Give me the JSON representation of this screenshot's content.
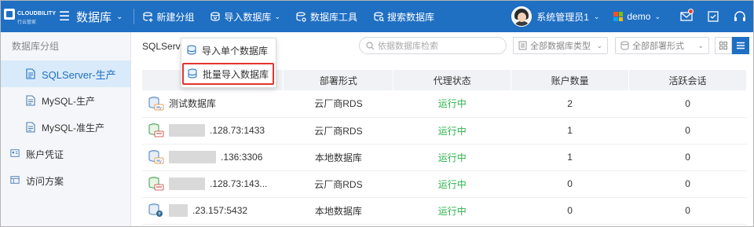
{
  "header": {
    "logo_text": "CLOUDBILITY",
    "logo_sub": "行云管家",
    "app_title": "数据库",
    "nav": [
      {
        "label": "新建分组",
        "icon": "new-group-icon"
      },
      {
        "label": "导入数据库",
        "icon": "import-db-icon"
      },
      {
        "label": "数据库工具",
        "icon": "db-tools-icon"
      },
      {
        "label": "搜索数据库",
        "icon": "search-db-icon"
      }
    ],
    "user_name": "系统管理员1",
    "org_name": "demo"
  },
  "sidebar": {
    "header": "数据库分组",
    "groups": [
      {
        "label": "SQLServer-生产",
        "active": true
      },
      {
        "label": "MySQL-生产",
        "active": false
      },
      {
        "label": "MySQL-准生产",
        "active": false
      }
    ],
    "items": [
      {
        "label": "账户凭证",
        "icon": "credential-icon"
      },
      {
        "label": "访问方案",
        "icon": "access-plan-icon"
      }
    ]
  },
  "main": {
    "breadcrumb": "SQLServer",
    "search_placeholder": "依据数据库检索",
    "filter_type": "全部数据库类型",
    "filter_deploy": "全部部署形式"
  },
  "dropdown": {
    "items": [
      "导入单个数据库",
      "批量导入数据库"
    ]
  },
  "table": {
    "columns": [
      "",
      "部署形式",
      "代理状态",
      "账户数量",
      "活跃会话"
    ],
    "rows": [
      {
        "name": "测试数据库",
        "icon": "mysql",
        "deploy": "云厂商RDS",
        "status": "运行中",
        "accounts": "2",
        "sessions": "0"
      },
      {
        "name": ".128.73:1433",
        "icon": "sqlserver",
        "deploy": "云厂商RDS",
        "status": "运行中",
        "accounts": "1",
        "sessions": "0"
      },
      {
        "name": ".136:3306",
        "icon": "mysql",
        "deploy": "本地数据库",
        "status": "运行中",
        "accounts": "1",
        "sessions": "0"
      },
      {
        "name": ".128.73:143...",
        "icon": "sqlserver",
        "deploy": "云厂商RDS",
        "status": "运行中",
        "accounts": "0",
        "sessions": "0"
      },
      {
        "name": ".23.157:5432",
        "icon": "postgres",
        "deploy": "本地数据库",
        "status": "运行中",
        "accounts": "0",
        "sessions": "0"
      }
    ]
  }
}
